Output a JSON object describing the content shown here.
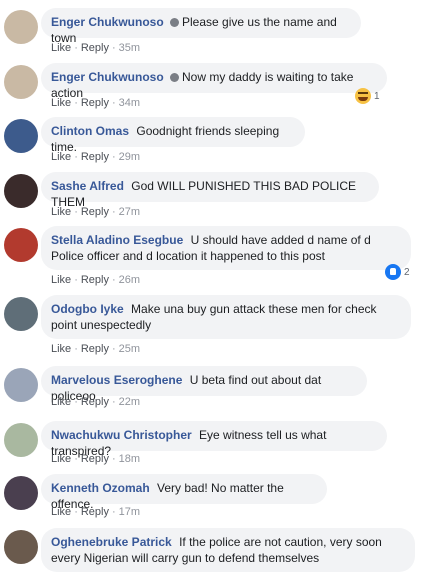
{
  "comments": [
    {
      "name": "Enger Chukwunoso",
      "badge": true,
      "text": "Please give us the name and town",
      "like": "Like",
      "reply": "Reply",
      "time": "35m",
      "avatar_color": "#c9b9a4"
    },
    {
      "name": "Enger Chukwunoso",
      "badge": true,
      "text": "Now my daddy is waiting to take action",
      "like": "Like",
      "reply": "Reply",
      "time": "34m",
      "avatar_color": "#c9b9a4",
      "reaction": {
        "icon": "haha-emoji-icon",
        "count": "1"
      }
    },
    {
      "name": "Clinton Omas",
      "text": "Goodnight friends sleeping time.",
      "like": "Like",
      "reply": "Reply",
      "time": "29m",
      "avatar_color": "#3d5b8c"
    },
    {
      "name": "Sashe Alfred",
      "text": "God WILL PUNISHED THIS BAD POLICE THEM",
      "like": "Like",
      "reply": "Reply",
      "time": "27m",
      "avatar_color": "#3a2b2b"
    },
    {
      "name": "Stella Aladino Esegbue",
      "text": "U should have added d name of d Police officer and d location it happened to this post",
      "like": "Like",
      "reply": "Reply",
      "time": "26m",
      "avatar_color": "#b23a2e",
      "reaction": {
        "icon": "like-reaction-icon",
        "count": "2"
      }
    },
    {
      "name": "Odogbo Iyke",
      "text": "Make una buy gun attack these men for check point unespectedly",
      "like": "Like",
      "reply": "Reply",
      "time": "25m",
      "avatar_color": "#5f6e78"
    },
    {
      "name": "Marvelous Eseroghene",
      "text": "U beta find out about dat policeoo",
      "like": "Like",
      "reply": "Reply",
      "time": "22m",
      "avatar_color": "#9aa5b8"
    },
    {
      "name": "Nwachukwu Christopher",
      "text": "Eye witness tell us what transpired?",
      "like": "Like",
      "reply": "Reply",
      "time": "18m",
      "avatar_color": "#a9b8a0"
    },
    {
      "name": "Kenneth Ozomah",
      "text": "Very bad! No matter the offence.",
      "like": "Like",
      "reply": "Reply",
      "time": "17m",
      "avatar_color": "#4a3f4f"
    },
    {
      "name": "Oghenebruke Patrick",
      "text": "If the police are not caution, very soon every Nigerian will carry gun to defend themselves",
      "like": "Like",
      "reply": "Reply",
      "time": "",
      "avatar_color": "#6a5a4d"
    }
  ]
}
